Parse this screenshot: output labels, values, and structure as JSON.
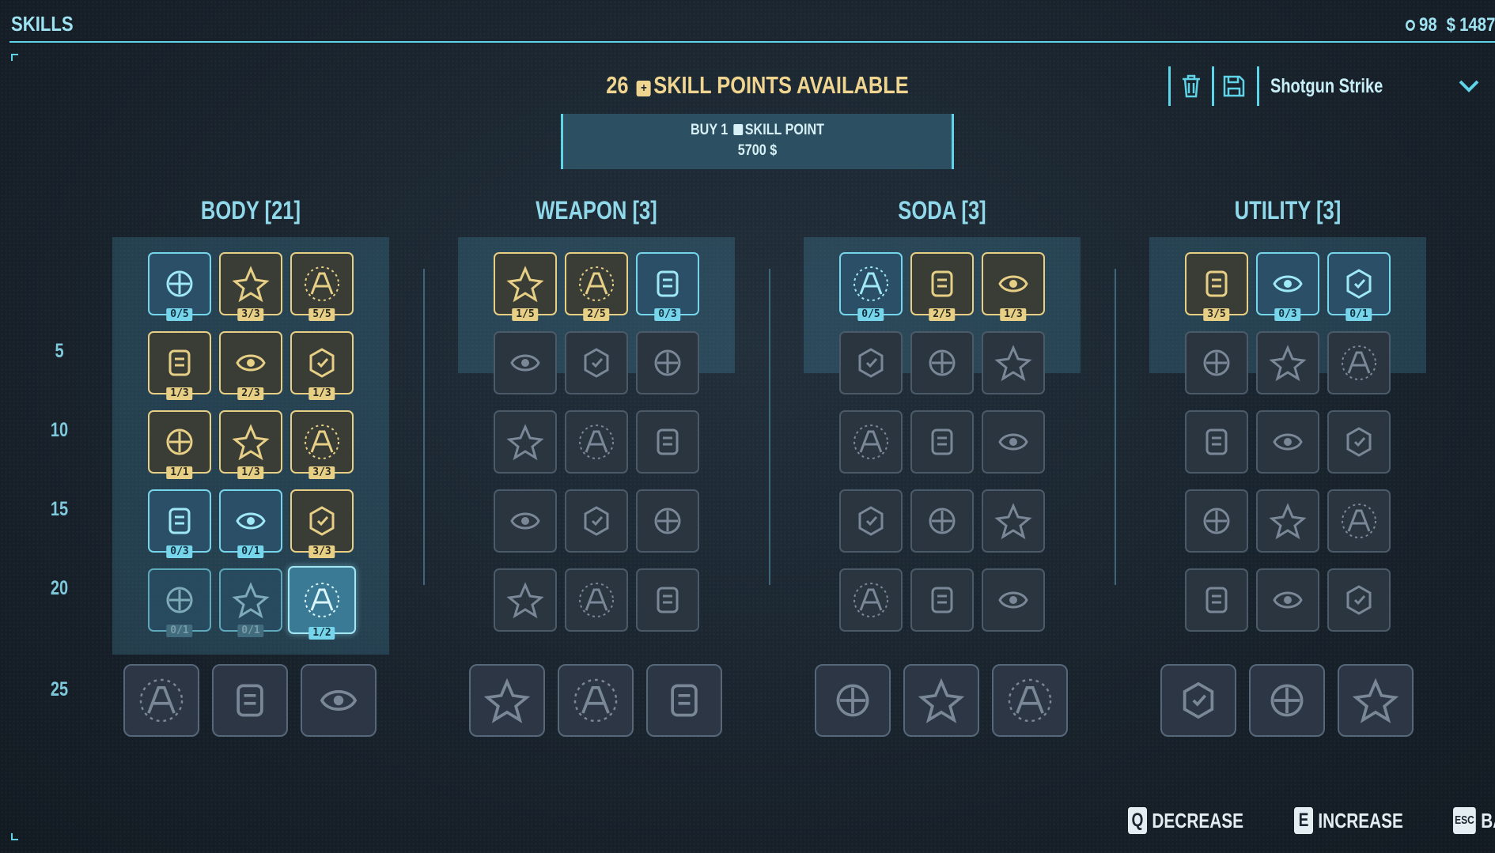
{
  "header": {
    "title": "SKILLS",
    "coins": "98",
    "money": "1487"
  },
  "skill_points": {
    "count": "26",
    "label": "SKILL POINTS AVAILABLE"
  },
  "buy": {
    "line1_prefix": "BUY 1",
    "line1_suffix": "SKILL POINT",
    "cost": "5700"
  },
  "loadout": {
    "selected": "Shotgun Strike",
    "delete_icon": "trash-icon",
    "save_icon": "floppy-disk-icon"
  },
  "levels": [
    "5",
    "10",
    "15",
    "20",
    "25"
  ],
  "columns": [
    {
      "name": "BODY",
      "count": "[21]",
      "rows": [
        [
          {
            "badge": "0/5",
            "state": "blue",
            "icon": "helmet-icon"
          },
          {
            "badge": "3/3",
            "state": "gold",
            "icon": "fist-burst-icon"
          },
          {
            "badge": "5/5",
            "state": "gold",
            "icon": "heart-icon"
          }
        ],
        [
          {
            "badge": "1/3",
            "state": "gold",
            "icon": "eye-shield-icon"
          },
          {
            "badge": "2/3",
            "state": "gold",
            "icon": "lightning-figure-icon"
          },
          {
            "badge": "1/3",
            "state": "gold",
            "icon": "rabbit-icon"
          }
        ],
        [
          {
            "badge": "1/1",
            "state": "gold",
            "icon": "figure-arrow-icon"
          },
          {
            "badge": "1/3",
            "state": "gold",
            "icon": "fist-ring-icon"
          },
          {
            "badge": "3/3",
            "state": "gold",
            "icon": "praying-hands-icon"
          }
        ],
        [
          {
            "badge": "0/3",
            "state": "blue",
            "icon": "fist-shield-icon"
          },
          {
            "badge": "0/1",
            "state": "blue",
            "icon": "skull-icon"
          },
          {
            "badge": "3/3",
            "state": "gold",
            "icon": "heart-badge-icon"
          }
        ],
        [
          {
            "badge": "0/1",
            "state": "dim",
            "icon": "fangs-icon"
          },
          {
            "badge": "0/1",
            "state": "dim",
            "icon": "punch-icon"
          },
          {
            "badge": "1/2",
            "state": "hl",
            "icon": "palm-icon"
          }
        ]
      ],
      "capstones": [
        "healing-hand-icon",
        "ninja-icon",
        "muscle-figure-icon"
      ]
    },
    {
      "name": "WEAPON",
      "count": "[3]",
      "rows": [
        [
          {
            "badge": "1/5",
            "state": "gold",
            "icon": "pistol-burst-icon"
          },
          {
            "badge": "2/5",
            "state": "gold",
            "icon": "revolver-icon"
          },
          {
            "badge": "0/3",
            "state": "blue",
            "icon": "bullets-hand-icon"
          }
        ],
        [
          {
            "state": "lock",
            "icon": "dragon-gun-icon"
          },
          {
            "state": "lock",
            "icon": "crosshair-icon"
          },
          {
            "state": "lock",
            "icon": "rising-bullets-icon"
          }
        ],
        [
          {
            "state": "lock",
            "icon": "gear-burst-icon"
          },
          {
            "state": "lock",
            "icon": "gun-icon"
          },
          {
            "state": "lock",
            "icon": "magazine-icon"
          }
        ],
        [
          {
            "state": "lock",
            "icon": "shotgun-blast-icon"
          },
          {
            "state": "lock",
            "icon": "rocket-icon"
          },
          {
            "state": "lock",
            "icon": "bullet-planet-icon"
          }
        ],
        [
          {
            "state": "lock",
            "icon": "explosion-icon"
          },
          {
            "state": "lock",
            "icon": "cycle-arrows-icon"
          },
          {
            "state": "lock",
            "icon": "lightning-circle-icon"
          }
        ]
      ],
      "capstones": [
        "muscle-gun-icon",
        "rocket-launch-icon",
        "orbit-bullet-icon"
      ]
    },
    {
      "name": "SODA",
      "count": "[3]",
      "rows": [
        [
          {
            "badge": "0/5",
            "state": "blue",
            "icon": "can-burst-icon"
          },
          {
            "badge": "2/5",
            "state": "gold",
            "icon": "open-can-icon"
          },
          {
            "badge": "1/3",
            "state": "gold",
            "icon": "pull-tab-icon"
          }
        ],
        [
          {
            "state": "lock",
            "icon": "monster-icon"
          },
          {
            "state": "lock",
            "icon": "medal-icon"
          },
          {
            "state": "lock",
            "icon": "dice-icon"
          }
        ],
        [
          {
            "state": "lock",
            "icon": "bomb-icon"
          },
          {
            "state": "lock",
            "icon": "lightning-bolt-icon"
          },
          {
            "state": "lock",
            "icon": "magnifier-icon"
          }
        ],
        [
          {
            "state": "lock",
            "icon": "drop-face-icon"
          },
          {
            "state": "lock",
            "icon": "gear-can-icon"
          },
          {
            "state": "lock",
            "icon": "scorpion-icon"
          }
        ],
        [
          {
            "state": "lock",
            "icon": "spiral-icon"
          },
          {
            "state": "lock",
            "icon": "swirl-icon"
          },
          {
            "state": "lock",
            "icon": "cans-icon"
          }
        ]
      ],
      "capstones": [
        "medic-plus-icon",
        "unicorn-icon",
        "pistol-icon"
      ]
    },
    {
      "name": "UTILITY",
      "count": "[3]",
      "rows": [
        [
          {
            "badge": "3/5",
            "state": "gold",
            "icon": "blade-orbit-icon"
          },
          {
            "badge": "0/3",
            "state": "blue",
            "icon": "biohazard-icon"
          },
          {
            "badge": "0/1",
            "state": "blue",
            "icon": "location-icon"
          }
        ],
        [
          {
            "state": "lock",
            "icon": "hooded-figure-icon"
          },
          {
            "state": "lock",
            "icon": "refresh-icon"
          },
          {
            "state": "lock",
            "icon": "dice-cycle-icon"
          }
        ],
        [
          {
            "state": "lock",
            "icon": "face-icon"
          },
          {
            "state": "lock",
            "icon": "hand-tool-icon"
          },
          {
            "state": "lock",
            "icon": "suit-figure-icon"
          }
        ],
        [
          {
            "state": "lock",
            "icon": "hourglass-icon"
          },
          {
            "state": "lock",
            "icon": "turtle-icon"
          },
          {
            "state": "lock",
            "icon": "vortex-icon"
          }
        ],
        [
          {
            "state": "lock",
            "icon": "hand-coin-icon"
          },
          {
            "state": "lock",
            "icon": "magnet-icon"
          },
          {
            "state": "lock",
            "icon": "dice-ring-icon"
          }
        ]
      ],
      "capstones": [
        "spray-can-icon",
        "crossed-axes-icon",
        "cards-icon"
      ]
    }
  ],
  "footer": [
    {
      "key": "Q",
      "label": "DECREASE"
    },
    {
      "key": "E",
      "label": "INCREASE"
    },
    {
      "key": "ESC",
      "label": "BACK"
    }
  ],
  "colors": {
    "accent": "#5fd3e8",
    "gold": "#e7cf86",
    "background": "#1b2530"
  }
}
